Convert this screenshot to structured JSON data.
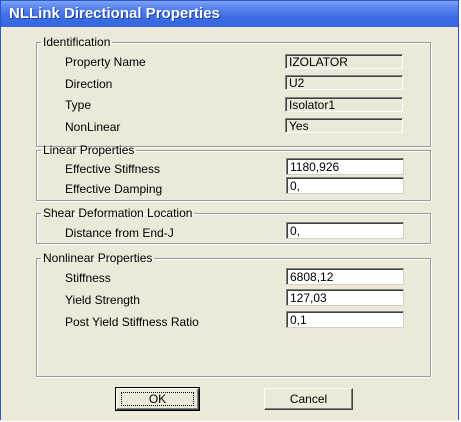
{
  "window": {
    "title": "NLLink Directional Properties"
  },
  "identification": {
    "legend": "Identification",
    "property_name": {
      "label": "Property Name",
      "value": "IZOLATOR"
    },
    "direction": {
      "label": "Direction",
      "value": "U2"
    },
    "type": {
      "label": "Type",
      "value": "Isolator1"
    },
    "nonlinear": {
      "label": "NonLinear",
      "value": "Yes"
    }
  },
  "linear": {
    "legend": "Linear Properties",
    "effective_stiffness": {
      "label": "Effective Stiffness",
      "value": "1180,926"
    },
    "effective_damping": {
      "label": "Effective Damping",
      "value": "0,"
    }
  },
  "shear": {
    "legend": "Shear Deformation Location",
    "distance": {
      "label": "Distance from End-J",
      "value": "0,"
    }
  },
  "nonlinear_props": {
    "legend": "Nonlinear Properties",
    "stiffness": {
      "label": "Stiffness",
      "value": "6808,12"
    },
    "yield_strength": {
      "label": "Yield Strength",
      "value": "127,03"
    },
    "post_yield_ratio": {
      "label": "Post Yield Stiffness Ratio",
      "value": "0,1"
    }
  },
  "buttons": {
    "ok": "OK",
    "cancel": "Cancel"
  }
}
